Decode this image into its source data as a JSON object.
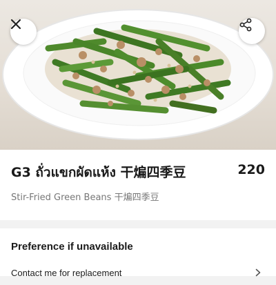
{
  "header": {
    "close_icon": "close-icon",
    "share_icon": "share-icon"
  },
  "item": {
    "title": "G3 ถั่วแขกผัดแห้ง 干煸四季豆",
    "price": "220",
    "description": "Stir-Fried Green Beans 干煸四季豆"
  },
  "preference": {
    "title": "Preference if unavailable",
    "option_label": "Contact me for replacement",
    "option_icon": "chevron-right-icon"
  },
  "colors": {
    "background": "#f2f2f2",
    "card": "#ffffff",
    "text_primary": "#1a1a1a",
    "text_secondary": "#777777"
  }
}
